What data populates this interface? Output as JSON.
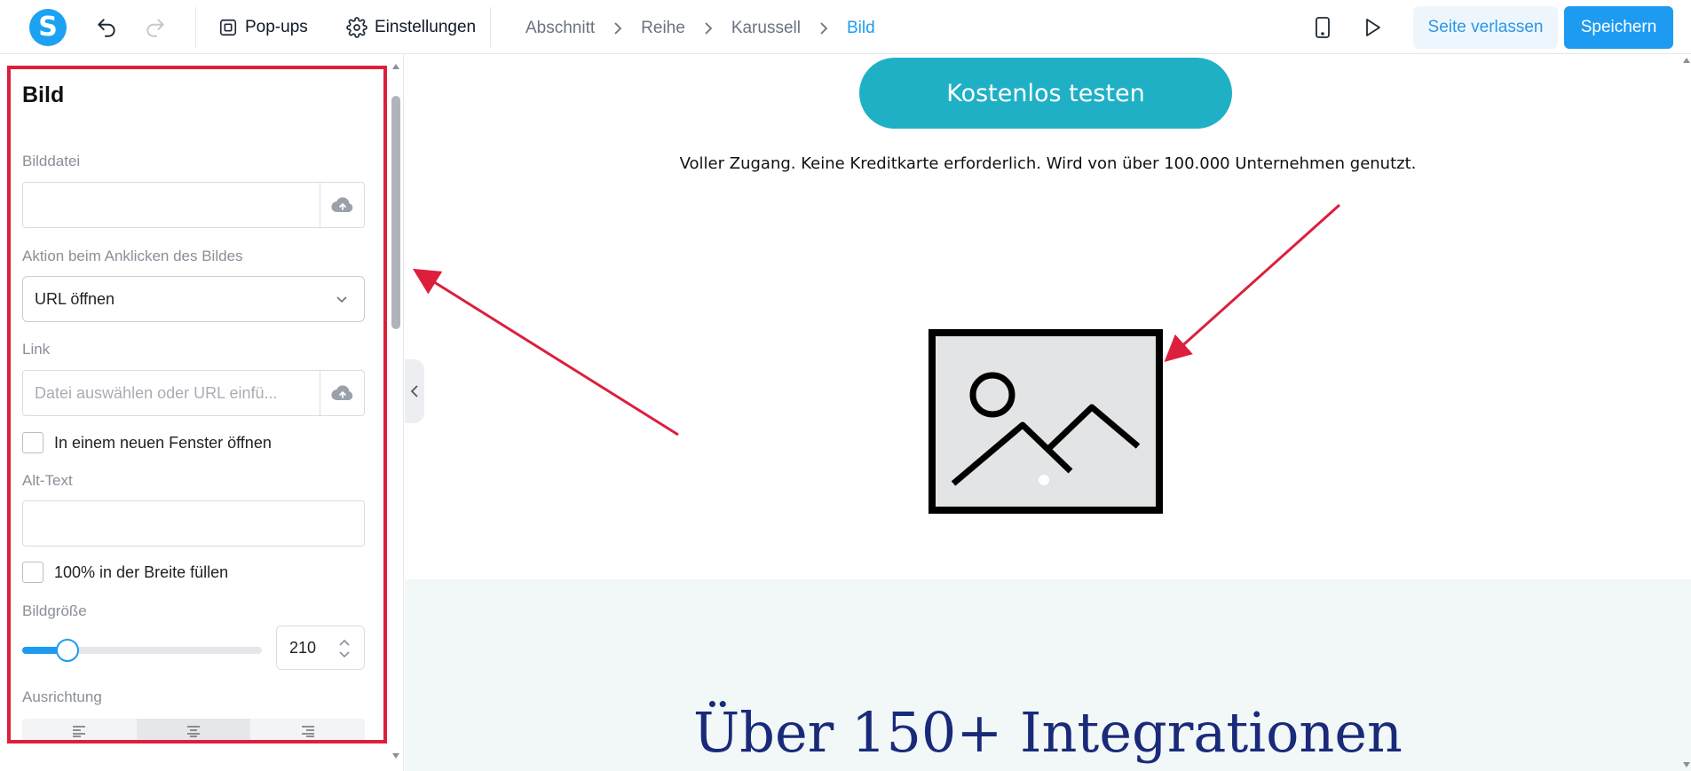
{
  "toolbar": {
    "logo": "S",
    "popups_label": "Pop-ups",
    "settings_label": "Einstellungen",
    "breadcrumbs": [
      "Abschnitt",
      "Reihe",
      "Karussell",
      "Bild"
    ],
    "leave_label": "Seite verlassen",
    "save_label": "Speichern"
  },
  "panel": {
    "title": "Bild",
    "image_file_label": "Bilddatei",
    "click_action_label": "Aktion beim Anklicken des Bildes",
    "click_action_value": "URL öffnen",
    "link_label": "Link",
    "link_placeholder": "Datei auswählen oder URL einfü...",
    "new_window_label": "In einem neuen Fenster öffnen",
    "alt_text_label": "Alt-Text",
    "full_width_label": "100% in der Breite füllen",
    "image_size_label": "Bildgröße",
    "image_size_value": "210",
    "image_size_fraction": 0.19,
    "alignment_label": "Ausrichtung"
  },
  "canvas": {
    "cta_label": "Kostenlos testen",
    "subline": "Voller Zugang. Keine Kreditkarte erforderlich. Wird von über 100.000 Unternehmen genutzt.",
    "heading": "Über 150+ Integrationen"
  },
  "colors": {
    "brand": "#1d9bf0",
    "cta": "#1fb0c6",
    "highlight": "#dc1f3c",
    "heading": "#1a2a7a"
  }
}
